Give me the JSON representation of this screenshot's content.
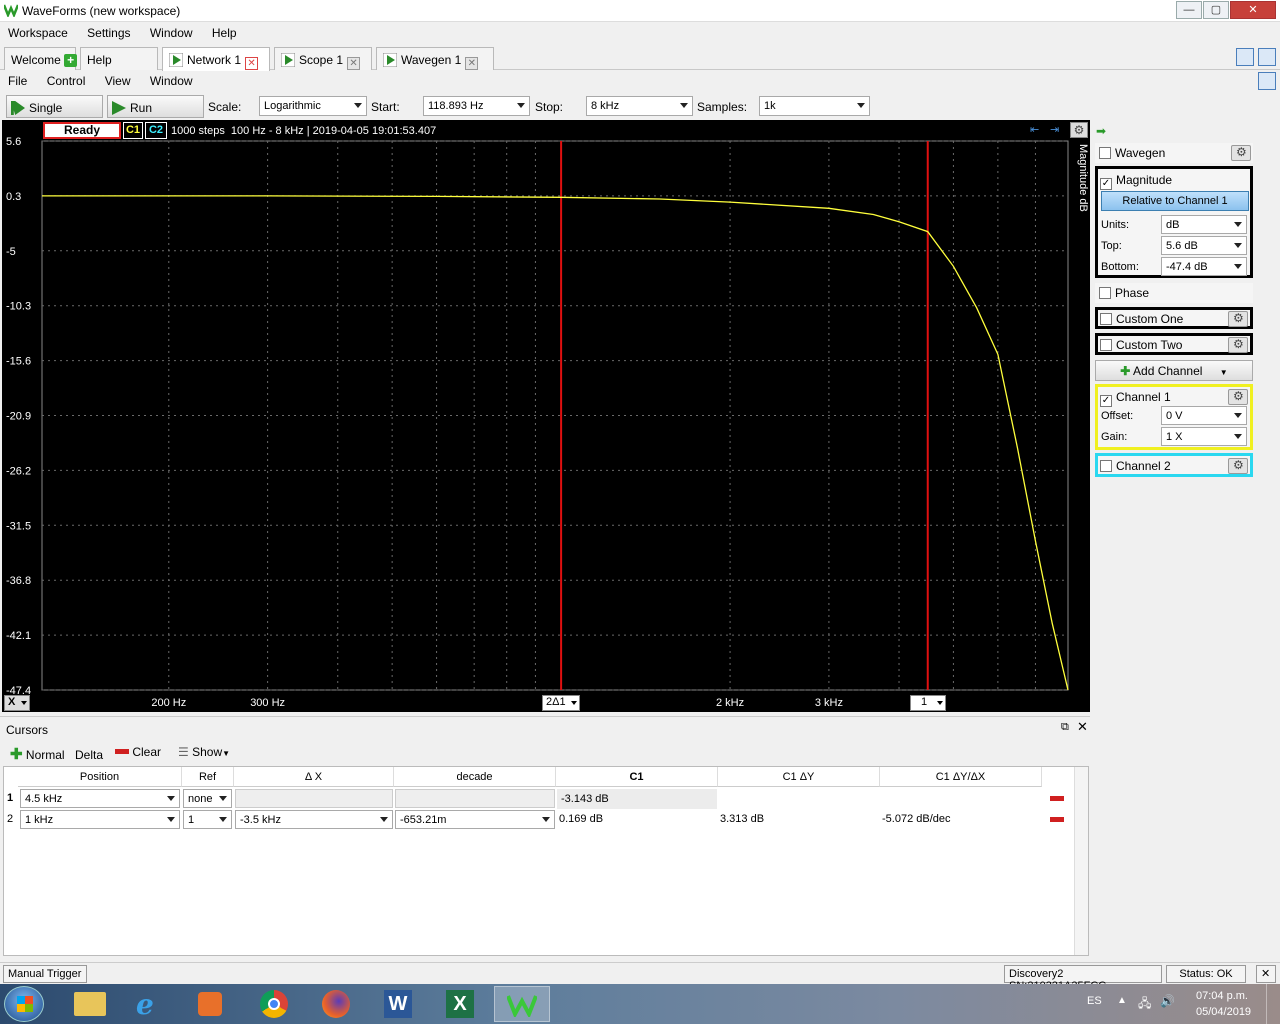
{
  "window": {
    "title": "WaveForms (new workspace)",
    "min": "—",
    "max": "▢",
    "close": "✕"
  },
  "menubar": [
    "Workspace",
    "Settings",
    "Window",
    "Help"
  ],
  "tabs": [
    {
      "label": "Welcome"
    },
    {
      "label": "Help"
    },
    {
      "label": "Network 1"
    },
    {
      "label": "Scope 1"
    },
    {
      "label": "Wavegen 1"
    }
  ],
  "submenu": [
    "File",
    "Control",
    "View",
    "Window"
  ],
  "toolbar": {
    "single": "Single",
    "run": "Run",
    "scale_label": "Scale:",
    "scale": "Logarithmic",
    "start_label": "Start:",
    "start": "118.893 Hz",
    "stop_label": "Stop:",
    "stop": "8 kHz",
    "samples_label": "Samples:",
    "samples": "1k"
  },
  "plot": {
    "status": "Ready",
    "c1": "C1",
    "c2": "C2",
    "info": "1000 steps  100 Hz - 8 kHz | 2019-04-05 19:01:53.407",
    "ylabel": "Magnitude dB",
    "x_btn": "X",
    "cursor1_label": "1",
    "cursor2_label": "2Δ1"
  },
  "chart_data": {
    "type": "line",
    "y_ticks": [
      "5.6",
      "0.3",
      "-5",
      "-10.3",
      "-15.6",
      "-20.9",
      "-26.2",
      "-31.5",
      "-36.8",
      "-42.1",
      "-47.4"
    ],
    "ylim": [
      -47.4,
      5.6
    ],
    "x_ticks": [
      {
        "label": "200 Hz",
        "value": 200
      },
      {
        "label": "300 Hz",
        "value": 300
      },
      {
        "label": "2 kHz",
        "value": 2000
      },
      {
        "label": "3 kHz",
        "value": 3000
      }
    ],
    "xlim": [
      118.893,
      8000
    ],
    "x_scale": "log",
    "series": [
      {
        "values_x": [
          118.893,
          300,
          600,
          1000,
          1500,
          2000,
          3000,
          3600,
          4000,
          4500,
          5000,
          5500,
          6000,
          6500,
          7000,
          7500,
          8000
        ],
        "values_y": [
          0.3,
          0.3,
          0.25,
          0.169,
          0.0,
          -0.3,
          -0.9,
          -1.5,
          -2.2,
          -3.143,
          -6.5,
          -10.5,
          -15.0,
          -24.0,
          -33.0,
          -41.0,
          -47.4
        ],
        "color": "#ffff3c"
      }
    ],
    "cursors": [
      {
        "x": 1000,
        "color": "#e01010"
      },
      {
        "x": 4500,
        "color": "#e01010"
      }
    ]
  },
  "cursors_panel": {
    "title": "Cursors",
    "normal": "Normal",
    "delta": "Delta",
    "clear": "Clear",
    "show": "Show",
    "headers": [
      "Position",
      "Ref",
      "Δ X",
      "decade",
      "C1",
      "C1 ΔY",
      "C1 ΔY/ΔX"
    ],
    "rows": [
      {
        "num": "1",
        "position": "4.5 kHz",
        "ref": "none",
        "dx": "",
        "decade": "",
        "c1": "-3.143 dB",
        "c1dy": "",
        "c1dydx": ""
      },
      {
        "num": "2",
        "position": "1 kHz",
        "ref": "1",
        "dx": "-3.5 kHz",
        "decade": "-653.21m",
        "c1": "0.169 dB",
        "c1dy": "3.313 dB",
        "c1dydx": "-5.072 dB/dec"
      }
    ]
  },
  "right_panel": {
    "wavegen": "Wavegen",
    "magnitude": "Magnitude",
    "relative": "Relative to Channel 1",
    "units_label": "Units:",
    "units": "dB",
    "top_label": "Top:",
    "top": "5.6 dB",
    "bottom_label": "Bottom:",
    "bottom": "-47.4 dB",
    "phase": "Phase",
    "custom_one": "Custom One",
    "custom_two": "Custom Two",
    "add_channel": "Add Channel",
    "channel1": "Channel 1",
    "offset_label": "Offset:",
    "offset": "0 V",
    "gain_label": "Gain:",
    "gain": "1 X",
    "channel2": "Channel 2"
  },
  "statusbar": {
    "manual_trigger": "Manual Trigger",
    "device": "Discovery2 SN:210321A35FCC",
    "status": "Status: OK"
  },
  "taskbar": {
    "lang": "ES",
    "time": "07:04 p.m.",
    "date": "05/04/2019"
  }
}
